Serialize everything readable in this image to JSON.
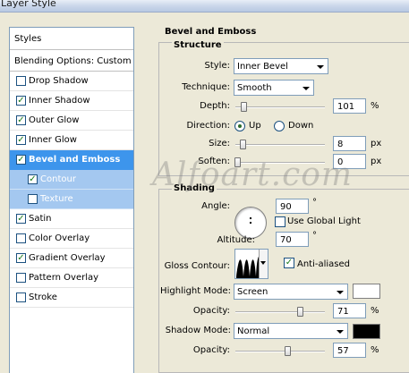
{
  "window": {
    "title": "Layer Style"
  },
  "sidebar": {
    "styles_label": "Styles",
    "blending_label": "Blending Options: Custom",
    "items": [
      {
        "label": "Drop Shadow",
        "checked": false
      },
      {
        "label": "Inner Shadow",
        "checked": true
      },
      {
        "label": "Outer Glow",
        "checked": true
      },
      {
        "label": "Inner Glow",
        "checked": true
      },
      {
        "label": "Bevel and Emboss",
        "checked": true,
        "selected": true
      },
      {
        "label": "Contour",
        "checked": true,
        "sub": true
      },
      {
        "label": "Texture",
        "checked": false,
        "sub": true
      },
      {
        "label": "Satin",
        "checked": true
      },
      {
        "label": "Color Overlay",
        "checked": false
      },
      {
        "label": "Gradient Overlay",
        "checked": true
      },
      {
        "label": "Pattern Overlay",
        "checked": false
      },
      {
        "label": "Stroke",
        "checked": false
      }
    ]
  },
  "panel": {
    "title": "Bevel and Emboss",
    "structure": {
      "title": "Structure",
      "style_label": "Style:",
      "style_value": "Inner Bevel",
      "technique_label": "Technique:",
      "technique_value": "Smooth",
      "depth_label": "Depth:",
      "depth_value": "101",
      "depth_unit": "%",
      "direction_label": "Direction:",
      "direction_up": "Up",
      "direction_down": "Down",
      "size_label": "Size:",
      "size_value": "8",
      "size_unit": "px",
      "soften_label": "Soften:",
      "soften_value": "0",
      "soften_unit": "px"
    },
    "shading": {
      "title": "Shading",
      "angle_label": "Angle:",
      "angle_value": "90",
      "angle_unit": "°",
      "global_light_label": "Use Global Light",
      "altitude_label": "Altitude:",
      "altitude_value": "70",
      "altitude_unit": "°",
      "gloss_label": "Gloss Contour:",
      "anti_aliased_label": "Anti-aliased",
      "highlight_label": "Highlight Mode:",
      "highlight_value": "Screen",
      "highlight_color": "#ffffff",
      "highlight_opacity_label": "Opacity:",
      "highlight_opacity_value": "71",
      "highlight_opacity_unit": "%",
      "shadow_label": "Shadow Mode:",
      "shadow_value": "Normal",
      "shadow_color": "#000000",
      "shadow_opacity_label": "Opacity:",
      "shadow_opacity_value": "57",
      "shadow_opacity_unit": "%"
    }
  },
  "watermark": "Alfoart.com"
}
